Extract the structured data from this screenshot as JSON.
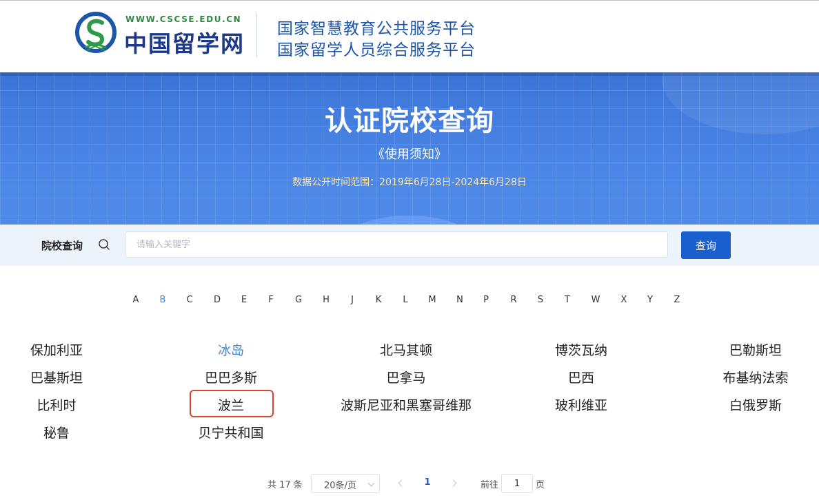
{
  "header": {
    "logo_url": "WWW.CSCSE.EDU.CN",
    "logo_name": "中国留学网",
    "platform_line1": "国家智慧教育公共服务平台",
    "platform_line2": "国家留学人员综合服务平台"
  },
  "banner": {
    "title": "认证院校查询",
    "notice_link": "《使用须知》",
    "date_range": "数据公开时间范围：2019年6月28日-2024年6月28日"
  },
  "search": {
    "label": "院校查询",
    "placeholder": "请输入关键字",
    "value": "",
    "button_label": "查询"
  },
  "letters": {
    "items": [
      "A",
      "B",
      "C",
      "D",
      "E",
      "F",
      "G",
      "H",
      "J",
      "K",
      "L",
      "M",
      "N",
      "P",
      "R",
      "S",
      "T",
      "W",
      "X",
      "Y",
      "Z"
    ],
    "active": "B"
  },
  "countries": {
    "items": [
      "保加利亚",
      "冰岛",
      "北马其顿",
      "博茨瓦纳",
      "巴勒斯坦",
      "巴基斯坦",
      "巴巴多斯",
      "巴拿马",
      "巴西",
      "布基纳法索",
      "比利时",
      "波兰",
      "波斯尼亚和黑塞哥维那",
      "玻利维亚",
      "白俄罗斯",
      "秘鲁",
      "贝宁共和国"
    ],
    "active": "冰岛",
    "highlighted": "波兰"
  },
  "pagination": {
    "total_text": "共 17 条",
    "page_size": "20条/页",
    "current_page": "1",
    "goto_label": "前往",
    "goto_value": "1",
    "page_unit": "页"
  },
  "colors": {
    "accent": "#1a5fd0",
    "active_text": "#3d88d9",
    "highlight_border": "#d9442a",
    "banner": "#4b86e6"
  }
}
